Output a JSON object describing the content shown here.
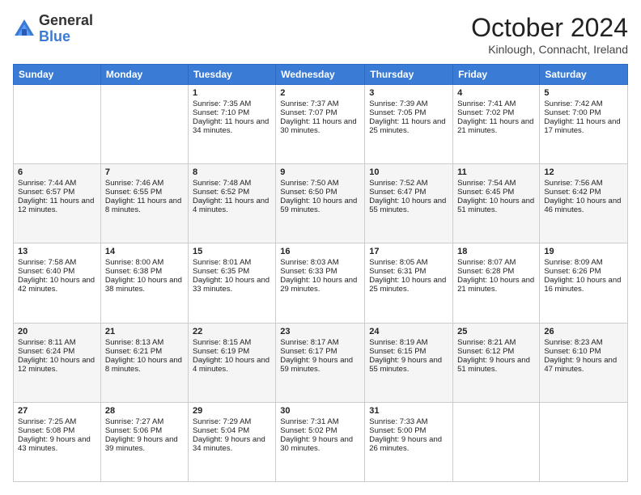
{
  "logo": {
    "general": "General",
    "blue": "Blue"
  },
  "title": "October 2024",
  "location": "Kinlough, Connacht, Ireland",
  "days_header": [
    "Sunday",
    "Monday",
    "Tuesday",
    "Wednesday",
    "Thursday",
    "Friday",
    "Saturday"
  ],
  "weeks": [
    [
      {
        "day": "",
        "content": ""
      },
      {
        "day": "",
        "content": ""
      },
      {
        "day": "1",
        "content": "Sunrise: 7:35 AM\nSunset: 7:10 PM\nDaylight: 11 hours and 34 minutes."
      },
      {
        "day": "2",
        "content": "Sunrise: 7:37 AM\nSunset: 7:07 PM\nDaylight: 11 hours and 30 minutes."
      },
      {
        "day": "3",
        "content": "Sunrise: 7:39 AM\nSunset: 7:05 PM\nDaylight: 11 hours and 25 minutes."
      },
      {
        "day": "4",
        "content": "Sunrise: 7:41 AM\nSunset: 7:02 PM\nDaylight: 11 hours and 21 minutes."
      },
      {
        "day": "5",
        "content": "Sunrise: 7:42 AM\nSunset: 7:00 PM\nDaylight: 11 hours and 17 minutes."
      }
    ],
    [
      {
        "day": "6",
        "content": "Sunrise: 7:44 AM\nSunset: 6:57 PM\nDaylight: 11 hours and 12 minutes."
      },
      {
        "day": "7",
        "content": "Sunrise: 7:46 AM\nSunset: 6:55 PM\nDaylight: 11 hours and 8 minutes."
      },
      {
        "day": "8",
        "content": "Sunrise: 7:48 AM\nSunset: 6:52 PM\nDaylight: 11 hours and 4 minutes."
      },
      {
        "day": "9",
        "content": "Sunrise: 7:50 AM\nSunset: 6:50 PM\nDaylight: 10 hours and 59 minutes."
      },
      {
        "day": "10",
        "content": "Sunrise: 7:52 AM\nSunset: 6:47 PM\nDaylight: 10 hours and 55 minutes."
      },
      {
        "day": "11",
        "content": "Sunrise: 7:54 AM\nSunset: 6:45 PM\nDaylight: 10 hours and 51 minutes."
      },
      {
        "day": "12",
        "content": "Sunrise: 7:56 AM\nSunset: 6:42 PM\nDaylight: 10 hours and 46 minutes."
      }
    ],
    [
      {
        "day": "13",
        "content": "Sunrise: 7:58 AM\nSunset: 6:40 PM\nDaylight: 10 hours and 42 minutes."
      },
      {
        "day": "14",
        "content": "Sunrise: 8:00 AM\nSunset: 6:38 PM\nDaylight: 10 hours and 38 minutes."
      },
      {
        "day": "15",
        "content": "Sunrise: 8:01 AM\nSunset: 6:35 PM\nDaylight: 10 hours and 33 minutes."
      },
      {
        "day": "16",
        "content": "Sunrise: 8:03 AM\nSunset: 6:33 PM\nDaylight: 10 hours and 29 minutes."
      },
      {
        "day": "17",
        "content": "Sunrise: 8:05 AM\nSunset: 6:31 PM\nDaylight: 10 hours and 25 minutes."
      },
      {
        "day": "18",
        "content": "Sunrise: 8:07 AM\nSunset: 6:28 PM\nDaylight: 10 hours and 21 minutes."
      },
      {
        "day": "19",
        "content": "Sunrise: 8:09 AM\nSunset: 6:26 PM\nDaylight: 10 hours and 16 minutes."
      }
    ],
    [
      {
        "day": "20",
        "content": "Sunrise: 8:11 AM\nSunset: 6:24 PM\nDaylight: 10 hours and 12 minutes."
      },
      {
        "day": "21",
        "content": "Sunrise: 8:13 AM\nSunset: 6:21 PM\nDaylight: 10 hours and 8 minutes."
      },
      {
        "day": "22",
        "content": "Sunrise: 8:15 AM\nSunset: 6:19 PM\nDaylight: 10 hours and 4 minutes."
      },
      {
        "day": "23",
        "content": "Sunrise: 8:17 AM\nSunset: 6:17 PM\nDaylight: 9 hours and 59 minutes."
      },
      {
        "day": "24",
        "content": "Sunrise: 8:19 AM\nSunset: 6:15 PM\nDaylight: 9 hours and 55 minutes."
      },
      {
        "day": "25",
        "content": "Sunrise: 8:21 AM\nSunset: 6:12 PM\nDaylight: 9 hours and 51 minutes."
      },
      {
        "day": "26",
        "content": "Sunrise: 8:23 AM\nSunset: 6:10 PM\nDaylight: 9 hours and 47 minutes."
      }
    ],
    [
      {
        "day": "27",
        "content": "Sunrise: 7:25 AM\nSunset: 5:08 PM\nDaylight: 9 hours and 43 minutes."
      },
      {
        "day": "28",
        "content": "Sunrise: 7:27 AM\nSunset: 5:06 PM\nDaylight: 9 hours and 39 minutes."
      },
      {
        "day": "29",
        "content": "Sunrise: 7:29 AM\nSunset: 5:04 PM\nDaylight: 9 hours and 34 minutes."
      },
      {
        "day": "30",
        "content": "Sunrise: 7:31 AM\nSunset: 5:02 PM\nDaylight: 9 hours and 30 minutes."
      },
      {
        "day": "31",
        "content": "Sunrise: 7:33 AM\nSunset: 5:00 PM\nDaylight: 9 hours and 26 minutes."
      },
      {
        "day": "",
        "content": ""
      },
      {
        "day": "",
        "content": ""
      }
    ]
  ]
}
